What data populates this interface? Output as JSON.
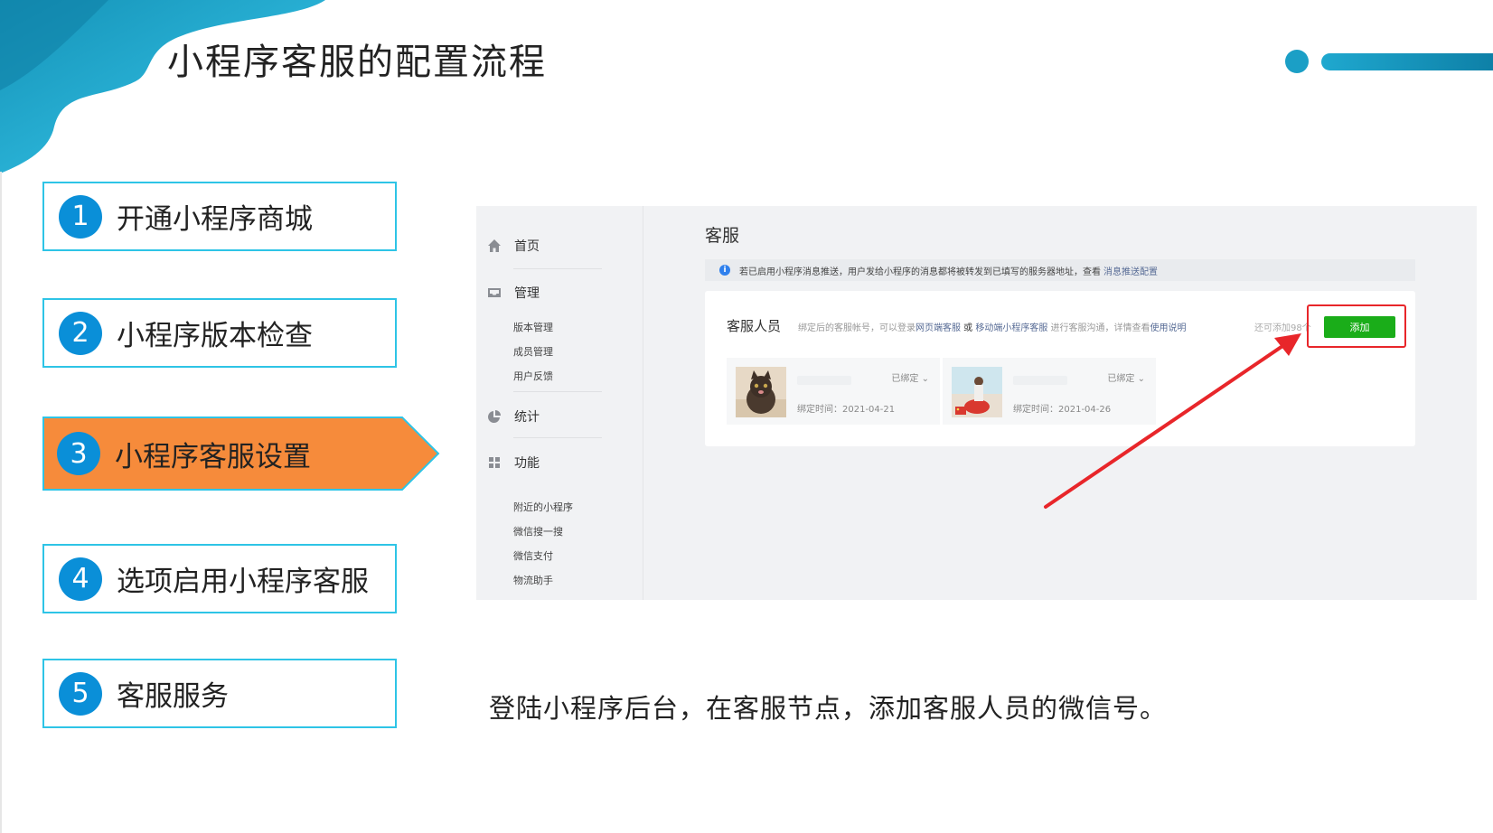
{
  "slide": {
    "title": "小程序客服的配置流程",
    "caption": "登陆小程序后台，在客服节点，添加客服人员的微信号。"
  },
  "steps": [
    {
      "num": "1",
      "label": "开通小程序商城",
      "active": false
    },
    {
      "num": "2",
      "label": "小程序版本检查",
      "active": false
    },
    {
      "num": "3",
      "label": "小程序客服设置",
      "active": true
    },
    {
      "num": "4",
      "label": "选项启用小程序客服",
      "active": false
    },
    {
      "num": "5",
      "label": "客服服务",
      "active": false
    }
  ],
  "colors": {
    "step_border": "#2ec4e6",
    "step_number_bg": "#0a8fd8",
    "active_step_fill": "#f68b3b",
    "add_button": "#1aad19",
    "highlight_red": "#e8262a",
    "deco_teal": "#1b9fc6"
  },
  "screenshot": {
    "nav": {
      "home": {
        "label": "首页",
        "icon": "home-icon"
      },
      "manage": {
        "label": "管理",
        "icon": "inbox-icon",
        "items": [
          "版本管理",
          "成员管理",
          "用户反馈"
        ]
      },
      "stats": {
        "label": "统计",
        "icon": "pie-chart-icon"
      },
      "functions": {
        "label": "功能",
        "icon": "grid-icon",
        "items": [
          "附近的小程序",
          "微信搜一搜",
          "微信支付",
          "物流助手"
        ]
      }
    },
    "heading": "客服",
    "notice": {
      "text": "若已启用小程序消息推送，用户发给小程序的消息都将被转发到已填写的服务器地址，查看",
      "link": "消息推送配置"
    },
    "card": {
      "title": "客服人员",
      "desc_1": "绑定后的客服帐号，可以登录",
      "desc_link_1": "网页端客服",
      "desc_or": " 或 ",
      "desc_link_2": "移动端小程序客服",
      "desc_2": " 进行客服沟通，详情查看",
      "desc_link_3": "使用说明",
      "remaining": "还可添加98个",
      "add_label": "添加"
    },
    "staff": [
      {
        "status": "已绑定",
        "time": "绑定时间：2021-04-21"
      },
      {
        "status": "已绑定",
        "time": "绑定时间：2021-04-26"
      }
    ]
  }
}
